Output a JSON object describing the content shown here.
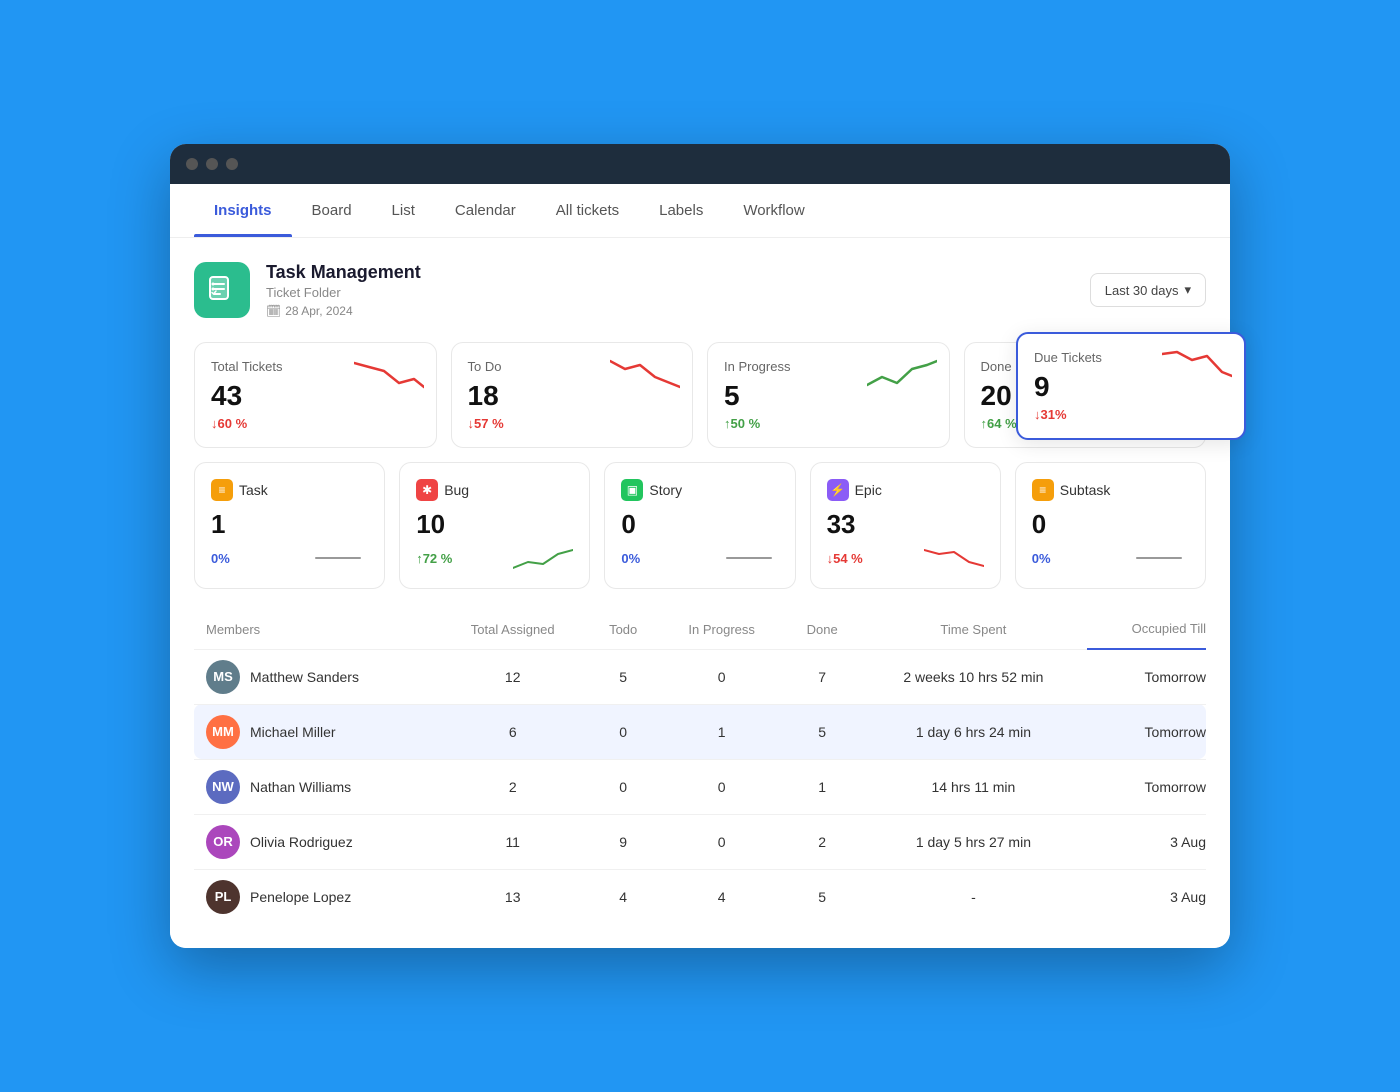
{
  "window": {
    "titlebar_dots": [
      "dot1",
      "dot2",
      "dot3"
    ]
  },
  "nav": {
    "items": [
      {
        "label": "Insights",
        "active": true
      },
      {
        "label": "Board",
        "active": false
      },
      {
        "label": "List",
        "active": false
      },
      {
        "label": "Calendar",
        "active": false
      },
      {
        "label": "All tickets",
        "active": false
      },
      {
        "label": "Labels",
        "active": false
      },
      {
        "label": "Workflow",
        "active": false
      }
    ]
  },
  "project": {
    "title": "Task Management",
    "subtitle": "Ticket Folder",
    "date": "28 Apr, 2024",
    "icon": "📋"
  },
  "date_filter": {
    "label": "Last 30 days"
  },
  "stats": [
    {
      "label": "Total Tickets",
      "value": "43",
      "change": "↓60 %",
      "change_type": "down",
      "sparkline": "down"
    },
    {
      "label": "To Do",
      "value": "18",
      "change": "↓57 %",
      "change_type": "down",
      "sparkline": "down"
    },
    {
      "label": "In Progress",
      "value": "5",
      "change": "↑50 %",
      "change_type": "up",
      "sparkline": "up"
    },
    {
      "label": "Done",
      "value": "20",
      "change": "↑64 %",
      "change_type": "up",
      "sparkline": "up"
    }
  ],
  "due_card": {
    "label": "Due Tickets",
    "value": "9",
    "change": "↓31%",
    "change_type": "down"
  },
  "types": [
    {
      "label": "Task",
      "value": "1",
      "change": "0%",
      "change_type": "neutral",
      "icon_color": "#f59e0b",
      "icon_char": "≡",
      "sparkline": "flat"
    },
    {
      "label": "Bug",
      "value": "10",
      "change": "↑72 %",
      "change_type": "up",
      "icon_color": "#ef4444",
      "icon_char": "✱",
      "sparkline": "up"
    },
    {
      "label": "Story",
      "value": "0",
      "change": "0%",
      "change_type": "neutral",
      "icon_color": "#22c55e",
      "icon_char": "▣",
      "sparkline": "flat"
    },
    {
      "label": "Epic",
      "value": "33",
      "change": "↓54 %",
      "change_type": "down",
      "icon_color": "#8b5cf6",
      "icon_char": "⚡",
      "sparkline": "down"
    },
    {
      "label": "Subtask",
      "value": "0",
      "change": "0%",
      "change_type": "neutral",
      "icon_color": "#f59e0b",
      "icon_char": "≡",
      "sparkline": "flat"
    }
  ],
  "table": {
    "columns": [
      "Members",
      "Total Assigned",
      "Todo",
      "In Progress",
      "Done",
      "Time Spent",
      "Occupied Till"
    ],
    "rows": [
      {
        "name": "Matthew Sanders",
        "avatar_bg": "#607d8b",
        "avatar_initials": "MS",
        "total": "12",
        "todo": "5",
        "inprogress": "0",
        "done": "7",
        "time_spent": "2 weeks 10 hrs 52 min",
        "occupied_till": "Tomorrow",
        "selected": false
      },
      {
        "name": "Michael Miller",
        "avatar_bg": "#ff7043",
        "avatar_initials": "MM",
        "total": "6",
        "todo": "0",
        "inprogress": "1",
        "done": "5",
        "time_spent": "1 day 6 hrs 24 min",
        "occupied_till": "Tomorrow",
        "selected": true
      },
      {
        "name": "Nathan Williams",
        "avatar_bg": "#5c6bc0",
        "avatar_initials": "NW",
        "total": "2",
        "todo": "0",
        "inprogress": "0",
        "done": "1",
        "time_spent": "14 hrs 11 min",
        "occupied_till": "Tomorrow",
        "selected": false
      },
      {
        "name": "Olivia Rodriguez",
        "avatar_bg": "#ab47bc",
        "avatar_initials": "OR",
        "total": "11",
        "todo": "9",
        "inprogress": "0",
        "done": "2",
        "time_spent": "1 day 5 hrs 27 min",
        "occupied_till": "3 Aug",
        "selected": false
      },
      {
        "name": "Penelope Lopez",
        "avatar_bg": "#4e342e",
        "avatar_initials": "PL",
        "total": "13",
        "todo": "4",
        "inprogress": "4",
        "done": "5",
        "time_spent": "-",
        "occupied_till": "3 Aug",
        "selected": false
      }
    ]
  }
}
